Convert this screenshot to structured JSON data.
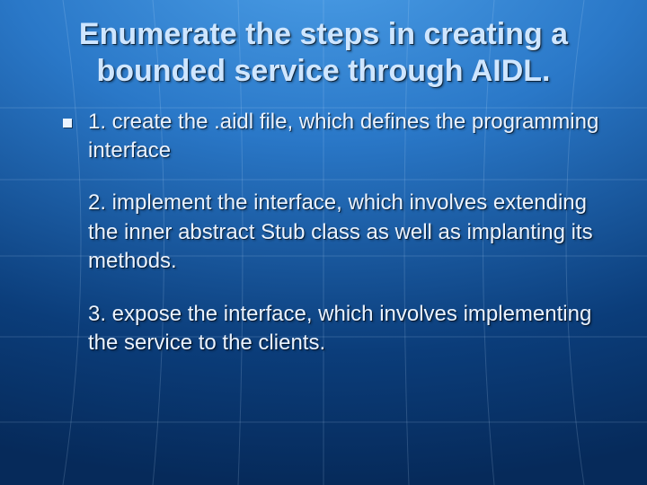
{
  "slide": {
    "title": "Enumerate the steps in creating a bounded service through AIDL.",
    "bullet": {
      "step1": "1. create the .aidl file, which defines the programming interface",
      "step2": "2. implement the interface, which involves extending the inner abstract Stub class as well as implanting its methods.",
      "step3": "3. expose the interface, which involves implementing the service to the clients."
    }
  }
}
